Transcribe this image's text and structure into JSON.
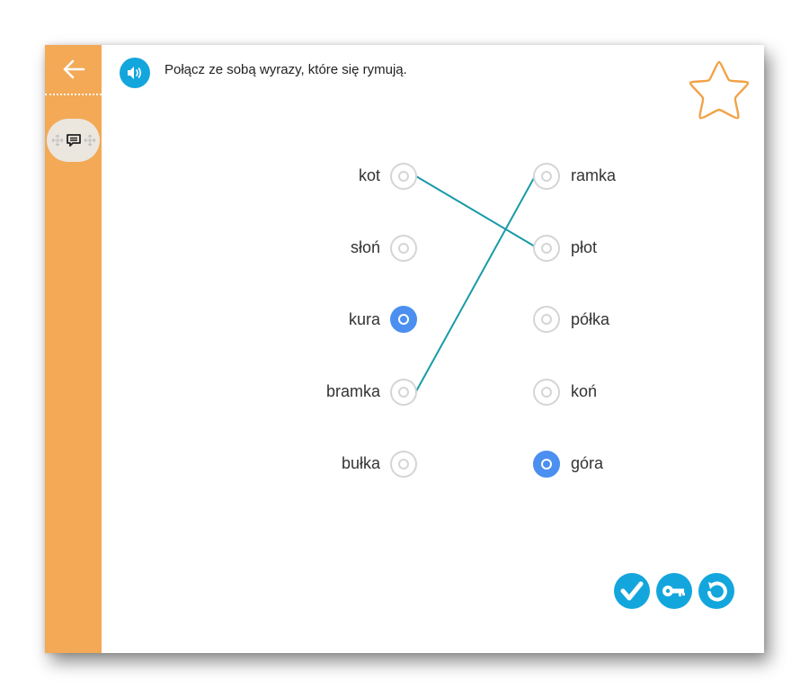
{
  "sidebar": {
    "back_icon": "arrow-left-icon",
    "mode_icons": [
      "move-icon",
      "chat-icon",
      "move-icon"
    ],
    "color": "#f3a955"
  },
  "exercise": {
    "instruction": "Połącz ze sobą wyrazy, które się rymują.",
    "audio_icon": "speaker-icon",
    "star_icon": "star-outline-icon",
    "left_words": [
      "kot",
      "słoń",
      "kura",
      "bramka",
      "bułka"
    ],
    "right_words": [
      "ramka",
      "płot",
      "półka",
      "koń",
      "góra"
    ],
    "selected": {
      "left": [
        "kura"
      ],
      "right": [
        "góra"
      ]
    },
    "connections": [
      {
        "from": "kot",
        "to": "płot"
      },
      {
        "from": "bramka",
        "to": "ramka"
      }
    ],
    "line_color": "#1a9aa8",
    "accent_color": "#13a6dd",
    "selected_color": "#4b8ff0"
  },
  "actions": {
    "check_icon": "checkmark-icon",
    "key_icon": "key-icon",
    "reset_icon": "reset-icon"
  }
}
